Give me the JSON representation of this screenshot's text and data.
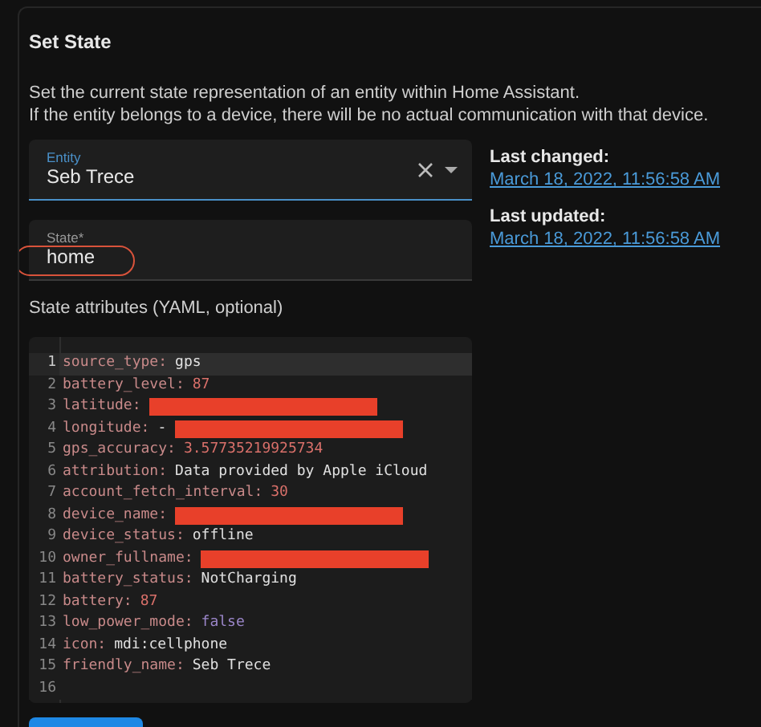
{
  "card": {
    "title": "Set State",
    "description": [
      "Set the current state representation of an entity within Home Assistant.",
      "If the entity belongs to a device, there will be no actual communication with that device."
    ]
  },
  "entity_field": {
    "label": "Entity",
    "value": "Seb Trece",
    "focused": true
  },
  "state_field": {
    "label": "State*",
    "value": "home",
    "circled": true
  },
  "timestamps": [
    {
      "label": "Last changed:",
      "value": "March 18, 2022, 11:56:58 AM"
    },
    {
      "label": "Last updated:",
      "value": "March 18, 2022, 11:56:58 AM"
    }
  ],
  "attributes_label": "State attributes (YAML, optional)",
  "code_lines": [
    {
      "number": "1",
      "key": "source_type:",
      "value": "gps",
      "kind": "string",
      "redacted": false,
      "active": true
    },
    {
      "number": "2",
      "key": "battery_level:",
      "value": "87",
      "kind": "number",
      "redacted": false,
      "active": false
    },
    {
      "number": "3",
      "key": "latitude:",
      "redacted": true,
      "active": false
    },
    {
      "number": "4",
      "key": "longitude:",
      "value": "-",
      "kind": "string",
      "redacted": true,
      "active": false
    },
    {
      "number": "5",
      "key": "gps_accuracy:",
      "value": "3.57735219925734",
      "kind": "number",
      "redacted": false,
      "active": false
    },
    {
      "number": "6",
      "key": "attribution:",
      "value": "Data provided by Apple iCloud",
      "kind": "string",
      "redacted": false,
      "active": false
    },
    {
      "number": "7",
      "key": "account_fetch_interval:",
      "value": "30",
      "kind": "number",
      "redacted": false,
      "active": false
    },
    {
      "number": "8",
      "key": "device_name:",
      "redacted": true,
      "active": false
    },
    {
      "number": "9",
      "key": "device_status:",
      "value": "offline",
      "kind": "string",
      "redacted": false,
      "active": false
    },
    {
      "number": "10",
      "key": "owner_fullname:",
      "redacted": true,
      "active": false
    },
    {
      "number": "11",
      "key": "battery_status:",
      "value": "NotCharging",
      "kind": "string",
      "redacted": false,
      "active": false
    },
    {
      "number": "12",
      "key": "battery:",
      "value": "87",
      "kind": "number",
      "redacted": false,
      "active": false
    },
    {
      "number": "13",
      "key": "low_power_mode:",
      "value": "false",
      "kind": "boolean",
      "redacted": false,
      "active": false
    },
    {
      "number": "14",
      "key": "icon:",
      "value": "mdi:cellphone",
      "kind": "string",
      "redacted": false,
      "active": false
    },
    {
      "number": "15",
      "key": "friendly_name:",
      "value": "Seb Trece",
      "kind": "string",
      "redacted": false,
      "active": false
    },
    {
      "number": "16",
      "active": false,
      "redacted": false
    }
  ]
}
